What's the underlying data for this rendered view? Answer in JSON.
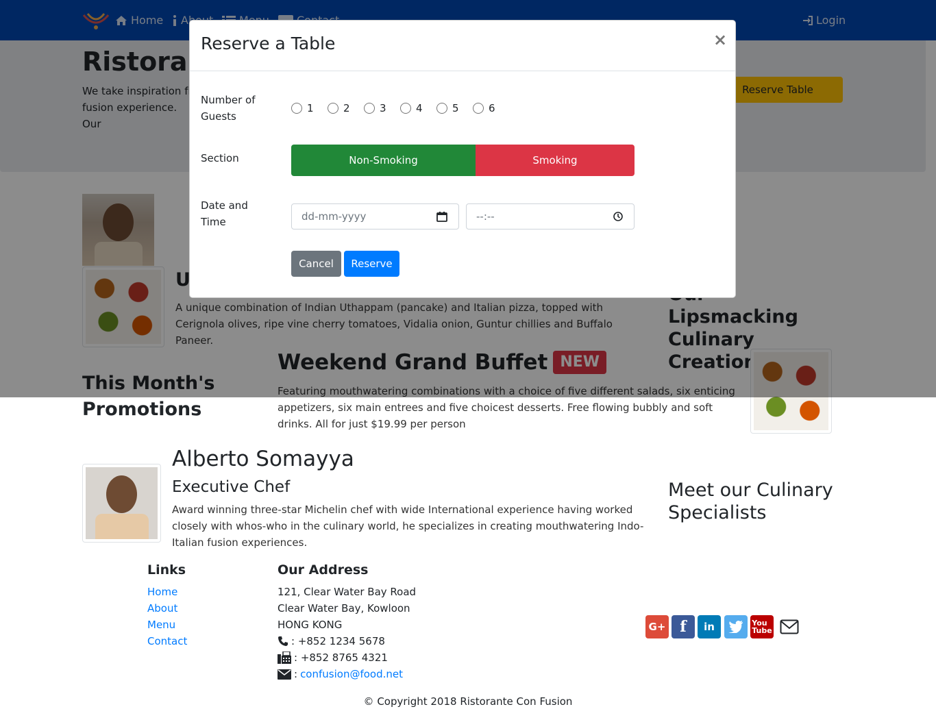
{
  "navbar": {
    "home": "Home",
    "about": "About",
    "menu": "Menu",
    "contact": "Contact",
    "login": "Login"
  },
  "jumbotron": {
    "title": "Ristorante",
    "text": "We take inspiration fro fusion experience. Our",
    "button": "Reserve Table"
  },
  "dish": {
    "title": "U",
    "description": "A unique combination of Indian Uthappam (pancake) and Italian pizza, topped with Cerignola olives, ripe vine cherry tomatoes, Vidalia onion, Guntur chillies and Buffalo Paneer."
  },
  "side_headings": {
    "creations": "Our Lipsmacking Culinary Creations",
    "promotions": "This Month's Promotions",
    "specialists": "Meet our Culinary Specialists"
  },
  "promotion": {
    "title": "Weekend Grand Buffet",
    "badge": "NEW",
    "description": "Featuring mouthwatering combinations with a choice of five different salads, six enticing appetizers, six main entrees and five choicest desserts. Free flowing bubbly and soft drinks. All for just $19.99 per person"
  },
  "leader": {
    "name": "Alberto Somayya",
    "role": "Executive Chef",
    "description": "Award winning three-star Michelin chef with wide International experience having worked closely with whos-who in the culinary world, he specializes in creating mouthwatering Indo-Italian fusion experiences."
  },
  "footer": {
    "links_heading": "Links",
    "links": [
      "Home",
      "About",
      "Menu",
      "Contact"
    ],
    "address_heading": "Our Address",
    "address_lines": [
      "121, Clear Water Bay Road",
      "Clear Water Bay, Kowloon",
      "HONG KONG"
    ],
    "phone": ": +852 1234 5678",
    "fax": ": +852 8765 4321",
    "email_prefix": ":",
    "email": "confusion@food.net",
    "copyright": "© Copyright 2018 Ristorante Con Fusion",
    "social_icons": [
      "google-plus-icon",
      "facebook-icon",
      "linkedin-icon",
      "twitter-icon",
      "youtube-icon",
      "envelope-icon"
    ]
  },
  "modal": {
    "title": "Reserve a Table",
    "close": "×",
    "guests_label": "Number of Guests",
    "guest_options": [
      "1",
      "2",
      "3",
      "4",
      "5",
      "6"
    ],
    "section_label": "Section",
    "section_options": [
      "Non-Smoking",
      "Smoking"
    ],
    "datetime_label": "Date and Time",
    "date_placeholder": "dd-mm-yyyy",
    "time_placeholder": "--:--",
    "cancel": "Cancel",
    "reserve": "Reserve"
  },
  "colors": {
    "navbar": "#0047b2",
    "warning": "#ffc107",
    "success": "#218838",
    "danger": "#dc3545",
    "primary": "#007bff",
    "secondary": "#6c757d"
  }
}
